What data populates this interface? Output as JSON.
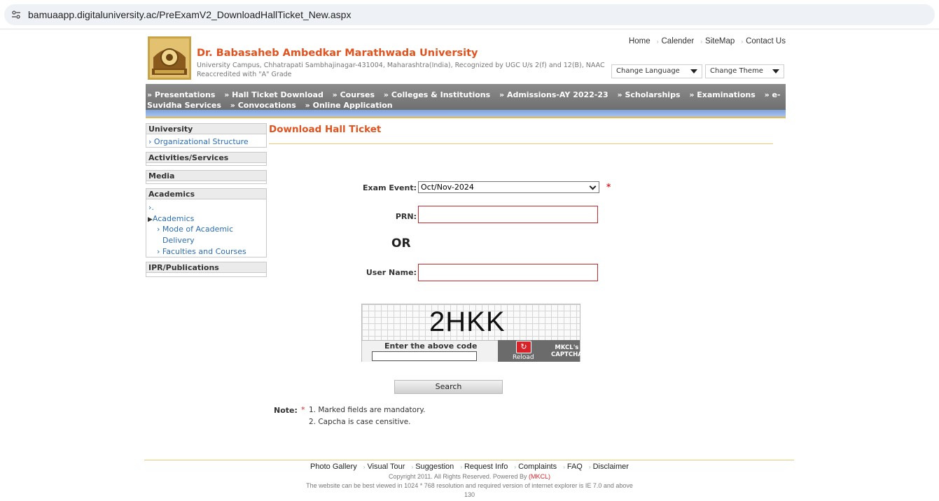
{
  "browser": {
    "url": "bamuaapp.digitaluniversity.ac/PreExamV2_DownloadHallTicket_New.aspx"
  },
  "header": {
    "university_name": "Dr. Babasaheb Ambedkar Marathwada University",
    "address": "University Campus, Chhatrapati Sambhajinagar-431004, Maharashtra(India), Recognized by UGC U/s 2(f) and 12(B), NAAC Reaccredited with \"A\" Grade",
    "top_links": [
      "Home",
      "Calender",
      "SiteMap",
      "Contact Us"
    ],
    "change_language": "Change Language",
    "change_theme": "Change Theme"
  },
  "menu": {
    "items": [
      "» Presentations",
      "» Hall Ticket Download",
      "» Courses",
      "» Colleges & Institutions",
      "» Admissions-AY 2022-23",
      "» Scholarships",
      "» Examinations",
      "» e-Suvidha Services",
      "» Convocations",
      "» Online Application"
    ]
  },
  "sidebar": {
    "university": "University",
    "org_structure": "Organizational Structure",
    "activities": "Activities/Services",
    "media": "Media",
    "academics": "Academics",
    "acad_dot": ".",
    "acad_academics": "Academics",
    "mode_line1": "Mode of Academic",
    "mode_line2": "Delivery",
    "faculties": "Faculties and Courses",
    "ipr": "IPR/Publications"
  },
  "form": {
    "title": "Download Hall Ticket",
    "exam_event_label": "Exam Event:",
    "exam_event_value": "Oct/Nov-2024",
    "required_mark": "*",
    "prn_label": "PRN:",
    "or_text": "OR",
    "username_label": "User Name:",
    "captcha_code": "2HKK",
    "captcha_prompt": "Enter the above code",
    "reload_label": "Reload",
    "captcha_brand_line1": "MKCL's",
    "captcha_brand_line2": "CAPTCHA",
    "search_label": "Search"
  },
  "note": {
    "label": "Note:",
    "star": "*",
    "line1": "1. Marked fields are mandatory.",
    "line2": "2. Capcha is case censitive."
  },
  "footer": {
    "links": [
      "Photo Gallery",
      "Visual Tour",
      "Suggestion",
      "Request Info",
      "Complaints",
      "FAQ",
      "Disclaimer"
    ],
    "copyright_prefix": "Copyright 2011. All Rights Reserved. Powered By",
    "copyright_brand": "(MKCL)",
    "resolution_note": "The website can be best viewed in 1024 * 768 resolution and required version of internet explorer is IE 7.0 and above",
    "counter": "130"
  },
  "colors": {
    "accent": "#e0531f",
    "link": "#2a6db5",
    "required": "#d9262b",
    "menu_bg": "#7d7d7d"
  }
}
